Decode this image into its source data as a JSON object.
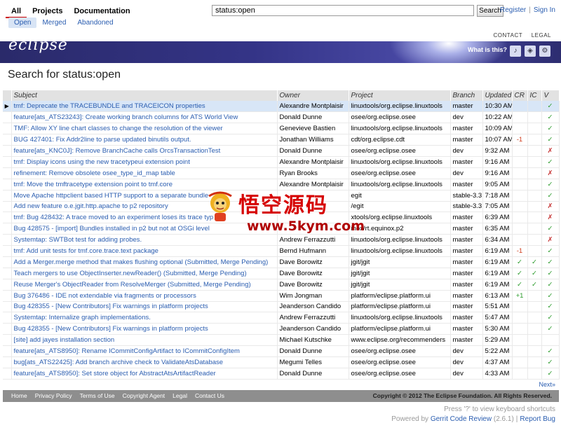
{
  "nav": {
    "main_tabs": [
      "All",
      "Projects",
      "Documentation"
    ],
    "sub_tabs": [
      "Open",
      "Merged",
      "Abandoned"
    ]
  },
  "search": {
    "value": "status:open",
    "button": "Search"
  },
  "user": {
    "register": "Register",
    "sign_in": "Sign In"
  },
  "banner": {
    "logo": "eclipse",
    "links": [
      "CONTACT",
      "LEGAL"
    ],
    "whatis": "What is this?",
    "icons": [
      "microphone-icon",
      "puzzle-icon",
      "gear-icon"
    ]
  },
  "page": {
    "title": "Search for status:open"
  },
  "table": {
    "headers": [
      "Subject",
      "Owner",
      "Project",
      "Branch",
      "Updated",
      "CR",
      "IC",
      "V"
    ],
    "rows": [
      [
        "tmf: Deprecate the TRACEBUNDLE and TRACEICON properties",
        "Alexandre Montplaisir",
        "linuxtools/org.eclipse.linuxtools",
        "master",
        "10:30 AM",
        "",
        "",
        "✓"
      ],
      [
        "feature[ats_ATS23243]: Create working branch columns for ATS World View",
        "Donald Dunne",
        "osee/org.eclipse.osee",
        "dev",
        "10:22 AM",
        "",
        "",
        "✓"
      ],
      [
        "TMF: Allow XY line chart classes to change the resolution of the viewer",
        "Genevieve Bastien",
        "linuxtools/org.eclipse.linuxtools",
        "master",
        "10:09 AM",
        "",
        "",
        "✓"
      ],
      [
        "BUG 427401: Fix Addr2line to parse updated binutils output.",
        "Jonathan Williams",
        "cdt/org.eclipse.cdt",
        "master",
        "10:07 AM",
        "-1",
        "",
        "✓"
      ],
      [
        "feature[ats_KNC0J]: Remove BranchCache calls OrcsTransactionTest",
        "Donald Dunne",
        "osee/org.eclipse.osee",
        "dev",
        "9:32 AM",
        "",
        "",
        "✗"
      ],
      [
        "tmf: Display icons using the new tracetypeui extension point",
        "Alexandre Montplaisir",
        "linuxtools/org.eclipse.linuxtools",
        "master",
        "9:16 AM",
        "",
        "",
        "✓"
      ],
      [
        "refinement: Remove obsolete osee_type_id_map table",
        "Ryan Brooks",
        "osee/org.eclipse.osee",
        "dev",
        "9:16 AM",
        "",
        "",
        "✗"
      ],
      [
        "tmf: Move the tmftracetype extension point to tmf.core",
        "Alexandre Montplaisir",
        "linuxtools/org.eclipse.linuxtools",
        "master",
        "9:05 AM",
        "",
        "",
        "✓"
      ],
      [
        "Move Apache httpclient based HTTP support to a separate bundle",
        "",
        "egit",
        "stable-3.3",
        "7:18 AM",
        "",
        "",
        "✓"
      ],
      [
        "Add new feature o.e.jgit.http.apache to p2 repository",
        "",
        "/egit",
        "stable-3.3",
        "7:05 AM",
        "",
        "",
        "✗"
      ],
      [
        "tmf: Bug 428432: A trace moved to an experiment loses its trace typ",
        "",
        "xtools/org.eclipse.linuxtools",
        "master",
        "6:39 AM",
        "",
        "",
        "✗"
      ],
      [
        "Bug 428575 - [import] Bundles installed in p2 but not at OSGi level",
        "",
        "inox/rt.equinox.p2",
        "master",
        "6:35 AM",
        "",
        "",
        "✓"
      ],
      [
        "Systemtap: SWTBot test for adding probes.",
        "Andrew Ferrazzutti",
        "linuxtools/org.eclipse.linuxtools",
        "master",
        "6:34 AM",
        "",
        "",
        "✗"
      ],
      [
        "tmf: Add unit tests for tmf.core.trace.text package",
        "Bernd Hufmann",
        "linuxtools/org.eclipse.linuxtools",
        "master",
        "6:19 AM",
        "-1",
        "",
        "✓"
      ],
      [
        "Add a Merger.merge method that makes flushing optional (Submitted, Merge Pending)",
        "Dave Borowitz",
        "jgit/jgit",
        "master",
        "6:19 AM",
        "✓",
        "✓",
        "✓"
      ],
      [
        "Teach mergers to use ObjectInserter.newReader() (Submitted, Merge Pending)",
        "Dave Borowitz",
        "jgit/jgit",
        "master",
        "6:19 AM",
        "✓",
        "✓",
        "✓"
      ],
      [
        "Reuse Merger's ObjectReader from ResolveMerger (Submitted, Merge Pending)",
        "Dave Borowitz",
        "jgit/jgit",
        "master",
        "6:19 AM",
        "✓",
        "✓",
        "✓"
      ],
      [
        "Bug 376486 - IDE not extendable via fragments or processors",
        "Wim Jongman",
        "platform/eclipse.platform.ui",
        "master",
        "6:13 AM",
        "+1",
        "",
        "✓"
      ],
      [
        "Bug 428355 - [New Contributors] Fix warnings in platform projects",
        "Jeanderson Candido",
        "platform/eclipse.platform.ui",
        "master",
        "5:51 AM",
        "",
        "",
        "✓"
      ],
      [
        "Systemtap: Internalize graph implementations.",
        "Andrew Ferrazzutti",
        "linuxtools/org.eclipse.linuxtools",
        "master",
        "5:47 AM",
        "",
        "",
        "✓"
      ],
      [
        "Bug 428355 - [New Contributors] Fix warnings in platform projects",
        "Jeanderson Candido",
        "platform/eclipse.platform.ui",
        "master",
        "5:30 AM",
        "",
        "",
        "✓"
      ],
      [
        "[site] add jayes installation section",
        "Michael Kutschke",
        "www.eclipse.org/recommenders",
        "master",
        "5:29 AM",
        "",
        "",
        ""
      ],
      [
        "feature[ats_ATS8950]: Rename ICommitConfigArtifact to ICommitConfigItem",
        "Donald Dunne",
        "osee/org.eclipse.osee",
        "dev",
        "5:22 AM",
        "",
        "",
        "✓"
      ],
      [
        "bug[ats_ATS22425]: Add branch archive check to ValidateAtsDatabase",
        "Megumi Telles",
        "osee/org.eclipse.osee",
        "dev",
        "4:37 AM",
        "",
        "",
        "✓"
      ],
      [
        "feature[ats_ATS8950]: Set store object for AbstractAtsArtifactReader",
        "Donald Dunne",
        "osee/org.eclipse.osee",
        "dev",
        "4:33 AM",
        "",
        "",
        "✓"
      ]
    ]
  },
  "next": "Next»",
  "footer": {
    "links": [
      "Home",
      "Privacy Policy",
      "Terms of Use",
      "Copyright Agent",
      "Legal",
      "Contact Us"
    ],
    "copyright": "Copyright © 2012 The Eclipse Foundation. All Rights Reserved."
  },
  "hint": "Press '?' to view keyboard shortcuts",
  "powered": {
    "prefix": "Powered by",
    "product": "Gerrit Code Review",
    "version": "(2.6.1)",
    "report": "Report Bug"
  },
  "watermark": {
    "title": "悟空源码",
    "url": "www.5kym.com"
  },
  "colors": {
    "banner": "#343487",
    "link": "#2a5db0",
    "ok": "#2d9c2d",
    "bad": "#c53030",
    "selected_row": "#d8e6f7"
  }
}
